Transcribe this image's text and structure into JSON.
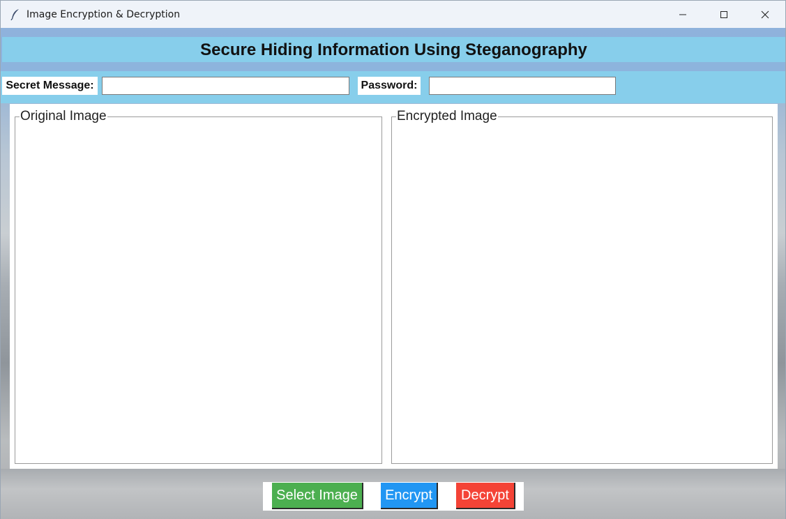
{
  "window": {
    "title": "Image Encryption & Decryption",
    "app_icon": "feather-icon",
    "controls": [
      "minimize-icon",
      "maximize-icon",
      "close-icon"
    ]
  },
  "header": {
    "title": "Secure Hiding Information Using Steganography",
    "background_color": "#87ceeb"
  },
  "form": {
    "secret_message_label": "Secret Message:",
    "secret_message_value": "",
    "password_label": "Password:",
    "password_value": ""
  },
  "panels": {
    "original_label": "Original Image",
    "encrypted_label": "Encrypted Image"
  },
  "buttons": {
    "select_label": "Select Image",
    "select_color": "#4caf50",
    "encrypt_label": "Encrypt",
    "encrypt_color": "#2196f3",
    "decrypt_label": "Decrypt",
    "decrypt_color": "#f44336"
  }
}
